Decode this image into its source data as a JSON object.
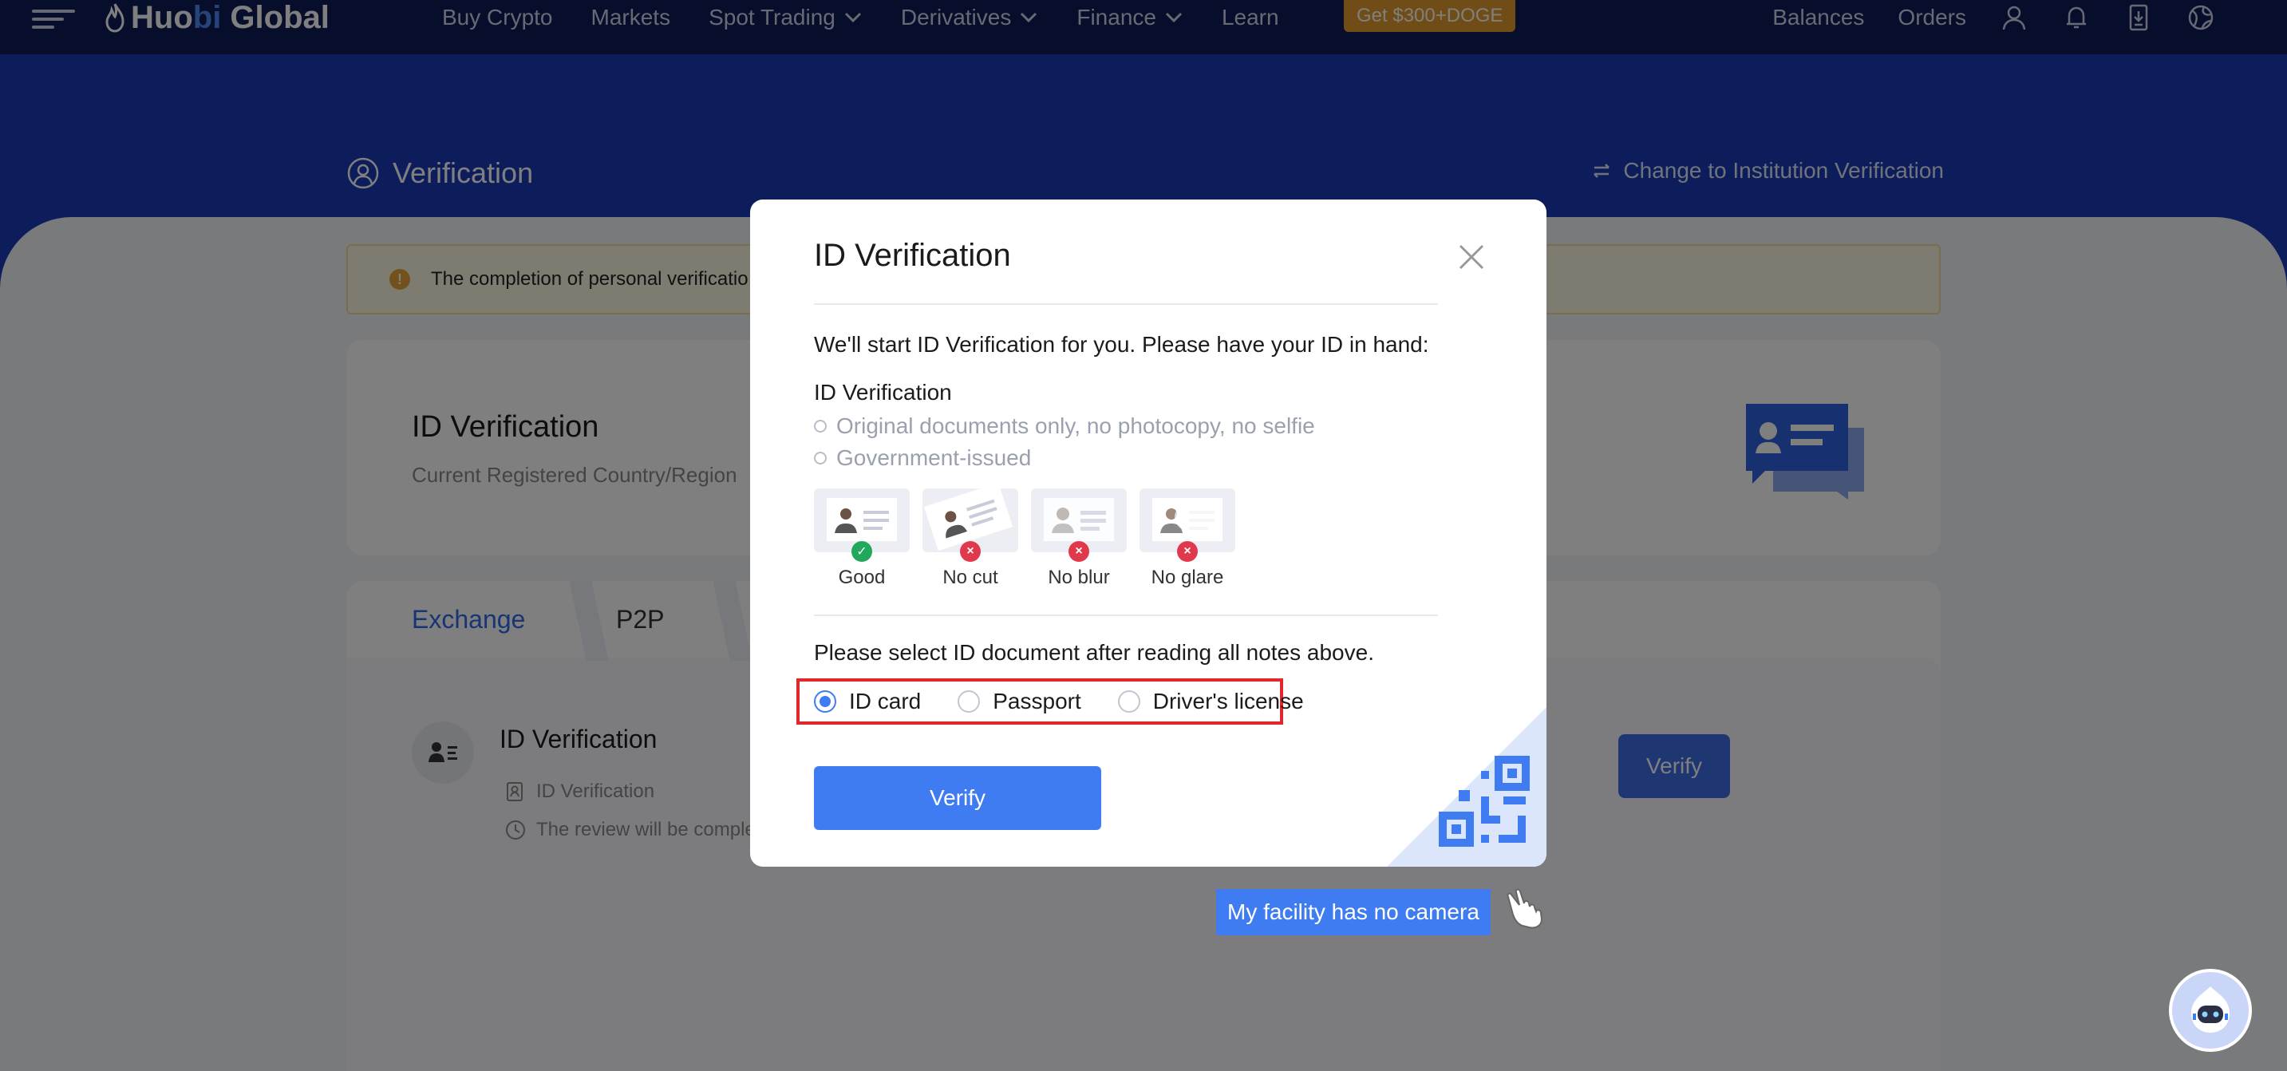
{
  "nav": {
    "logo_part1": "Huo",
    "logo_part2": "bi",
    "logo_part3": " Global",
    "links": [
      "Buy Crypto",
      "Markets",
      "Spot Trading",
      "Derivatives",
      "Finance",
      "Learn"
    ],
    "promo": "Get $300+DOGE",
    "balances": "Balances",
    "orders": "Orders"
  },
  "page": {
    "title": "Verification",
    "institution_link": "Change to Institution Verification",
    "alert": "The completion of personal verificatio",
    "card_title": "ID Verification",
    "card_sub": "Current Registered Country/Region",
    "tabs": [
      "Exchange",
      "P2P"
    ],
    "kyc_title": "ID Verification",
    "kyc_sub1": "ID Verification",
    "kyc_sub2": "The review will be comple",
    "verify": "Verify"
  },
  "modal": {
    "title": "ID Verification",
    "intro": "We'll start ID Verification for you. Please have your ID in hand:",
    "req_title": "ID Verification",
    "requirements": [
      "Original documents only, no photocopy, no selfie",
      "Government-issued"
    ],
    "samples": [
      "Good",
      "No cut",
      "No blur",
      "No glare"
    ],
    "select_note": "Please select ID document after reading all notes above.",
    "doc_types": [
      "ID card",
      "Passport",
      "Driver's license"
    ],
    "selected_doc": "ID card",
    "verify_button": "Verify"
  },
  "no_camera": "My facility has no camera",
  "colors": {
    "nav_bg": "#0f1c56",
    "hero_bg": "#1a3bb8",
    "accent": "#3f7cf2",
    "highlight_border": "#e0272c",
    "promo": "#e09a2e"
  }
}
